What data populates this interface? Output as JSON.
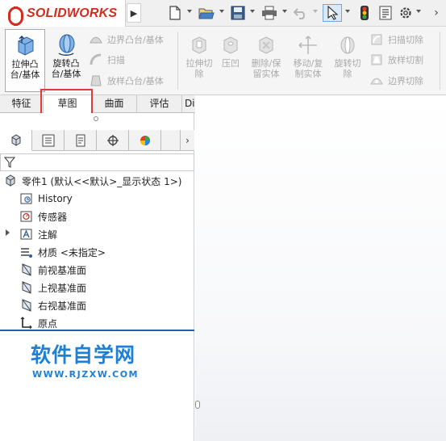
{
  "app": {
    "logo_brand": "SOLIDWORKS",
    "menu_arrow": "▶"
  },
  "quick_toolbar": {
    "icons": [
      "new-document-icon",
      "open-folder-icon",
      "save-icon",
      "print-icon",
      "undo-icon",
      "select-cursor-icon",
      "traffic-light-icon",
      "file-properties-icon",
      "options-gear-icon"
    ],
    "more": "›"
  },
  "ribbon": {
    "extruded_boss": "拉伸凸\n台/基体",
    "revolved_boss": "旋转凸\n台/基体",
    "boundary_boss": "边界凸台/基体",
    "sweep": "扫描",
    "loft_boss": "放样凸台/基体",
    "extruded_cut": "拉伸切\n除",
    "hole_wizard": "压凹",
    "delete_keep_body": "删除/保\n留实体",
    "move_copy_body": "移动/复\n制实体",
    "revolved_cut": "旋转切\n除",
    "swept_cut": "扫描切除",
    "lofted_cut": "放样切割",
    "boundary_cut": "边界切除"
  },
  "tabs": [
    {
      "label": "特征"
    },
    {
      "label": "草图"
    },
    {
      "label": "曲面"
    },
    {
      "label": "评估"
    },
    {
      "label": "DimXpert"
    }
  ],
  "pane_tabs": {
    "more": "›"
  },
  "tree": {
    "root": "零件1  (默认<<默认>_显示状态 1>)",
    "items": [
      {
        "label": "History"
      },
      {
        "label": "传感器"
      },
      {
        "label": "注解"
      },
      {
        "label": "材质 <未指定>"
      },
      {
        "label": "前视基准面"
      },
      {
        "label": "上视基准面"
      },
      {
        "label": "右视基准面"
      },
      {
        "label": "原点"
      }
    ]
  },
  "watermark": {
    "title": "软件自学网",
    "url": "WWW.RJZXW.COM"
  },
  "colors": {
    "brand_red": "#d52b1e",
    "tab_highlight": "#e53935",
    "tree_divider": "#1c5fb3",
    "watermark": "#1e7fd6"
  }
}
